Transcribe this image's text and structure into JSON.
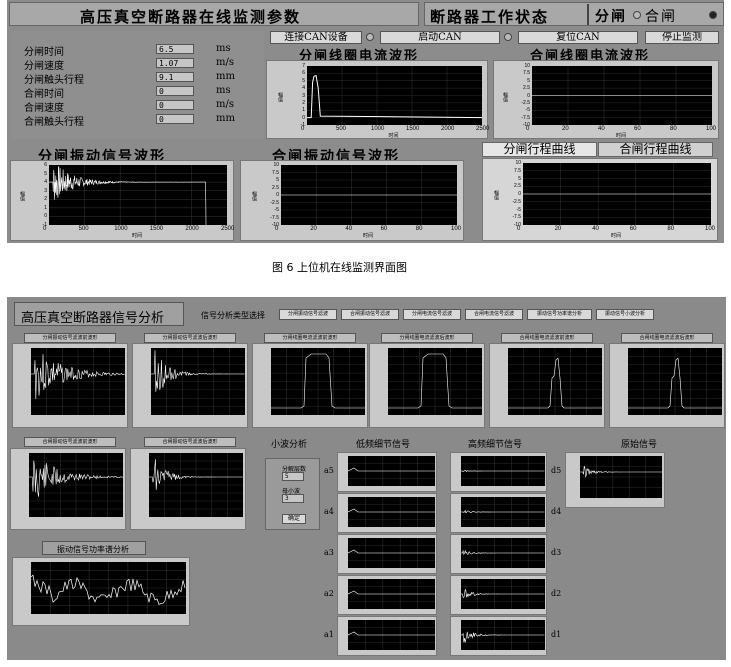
{
  "monitor": {
    "header_title": "高压真空断路器在线监测参数",
    "status_label": "断路器工作状态",
    "open_label": "分闸",
    "close_label": "合闸",
    "buttons": {
      "connect": "连接CAN设备",
      "start": "启动CAN",
      "reset": "复位CAN",
      "stop": "停止监测"
    },
    "params": [
      {
        "label": "分闸时间",
        "value": "6.5",
        "unit": "ms"
      },
      {
        "label": "分闸速度",
        "value": "1.07",
        "unit": "m/s"
      },
      {
        "label": "分闸触头行程",
        "value": "9.1",
        "unit": "mm"
      },
      {
        "label": "合闸时间",
        "value": "0",
        "unit": "ms"
      },
      {
        "label": "合闸速度",
        "value": "0",
        "unit": "m/s"
      },
      {
        "label": "合闸触头行程",
        "value": "0",
        "unit": "mm"
      }
    ],
    "plots": {
      "open_coil": {
        "title": "分闸线圈电流波形",
        "ylabel": "幅值",
        "xlabel": "时间",
        "yticks": [
          "7",
          "6",
          "5",
          "4",
          "3",
          "2",
          "1",
          "0",
          "-1"
        ],
        "xticks": [
          "0",
          "500",
          "1000",
          "1500",
          "2000",
          "2500"
        ]
      },
      "close_coil": {
        "title": "合闸线圈电流波形",
        "ylabel": "幅值",
        "xlabel": "时间",
        "yticks": [
          "10",
          "7.5",
          "5",
          "2.5",
          "0",
          "-2.5",
          "-5",
          "-7.5",
          "-10"
        ],
        "xticks": [
          "0",
          "20",
          "40",
          "60",
          "80",
          "100"
        ]
      },
      "open_vib": {
        "title": "分闸振动信号波形",
        "ylabel": "幅值",
        "xlabel": "时间",
        "yticks": [
          "6",
          "5",
          "4",
          "3",
          "2",
          "1",
          "0",
          "-1"
        ],
        "xticks": [
          "0",
          "500",
          "1000",
          "1500",
          "2000",
          "2500"
        ]
      },
      "close_vib": {
        "title": "合闸振动信号波形",
        "ylabel": "幅值",
        "xlabel": "时间",
        "yticks": [
          "10",
          "7.5",
          "5",
          "2.5",
          "0",
          "-2.5",
          "-5",
          "-7.5",
          "-10"
        ],
        "xticks": [
          "0",
          "20",
          "40",
          "60",
          "80",
          "100"
        ]
      },
      "travel": {
        "ylabel": "幅值",
        "xlabel": "时间",
        "yticks": [
          "10",
          "7.5",
          "5",
          "2.5",
          "0",
          "-2.5",
          "-5",
          "-7.5",
          "-10"
        ],
        "xticks": [
          "0",
          "20",
          "40",
          "60",
          "80",
          "100"
        ]
      }
    },
    "tabs": {
      "open_travel": "分闸行程曲线",
      "close_travel": "合闸行程曲线"
    }
  },
  "caption": "图 6   上位机在线监测界面图",
  "analysis": {
    "title": "高压真空断路器信号分析",
    "type_label": "信号分析类型选择",
    "type_buttons": [
      "分闸振动信号滤波",
      "合闸振动信号滤波",
      "分闸电流信号滤波",
      "合闸电流信号滤波",
      "振动信号功率谱分析",
      "振动信号小波分析"
    ],
    "row1": [
      "分闸振动信号滤波前波形",
      "分闸振动信号滤波后波形",
      "分闸线圈电流滤波前波形",
      "分闸线圈电流滤波后波形",
      "合闸线圈电流滤波前波形",
      "合闸线圈电流滤波后波形"
    ],
    "row2": [
      "合闸振动信号滤波前波形",
      "合闸振动信号滤波后波形"
    ],
    "wavelet_label": "小波分析",
    "low_label": "低频细节信号",
    "high_label": "高频细节信号",
    "orig_label": "原始信号",
    "ctrl_level": "分解层数",
    "ctrl_level_val": "5",
    "ctrl_wavelet": "母小波",
    "ctrl_wavelet_val": "3",
    "ok": "确定",
    "power_title": "振动信号功率谱分析",
    "a_labels": [
      "a5",
      "a4",
      "a3",
      "a2",
      "a1"
    ],
    "d_labels": [
      "d5",
      "d4",
      "d3",
      "d2",
      "d1"
    ]
  }
}
